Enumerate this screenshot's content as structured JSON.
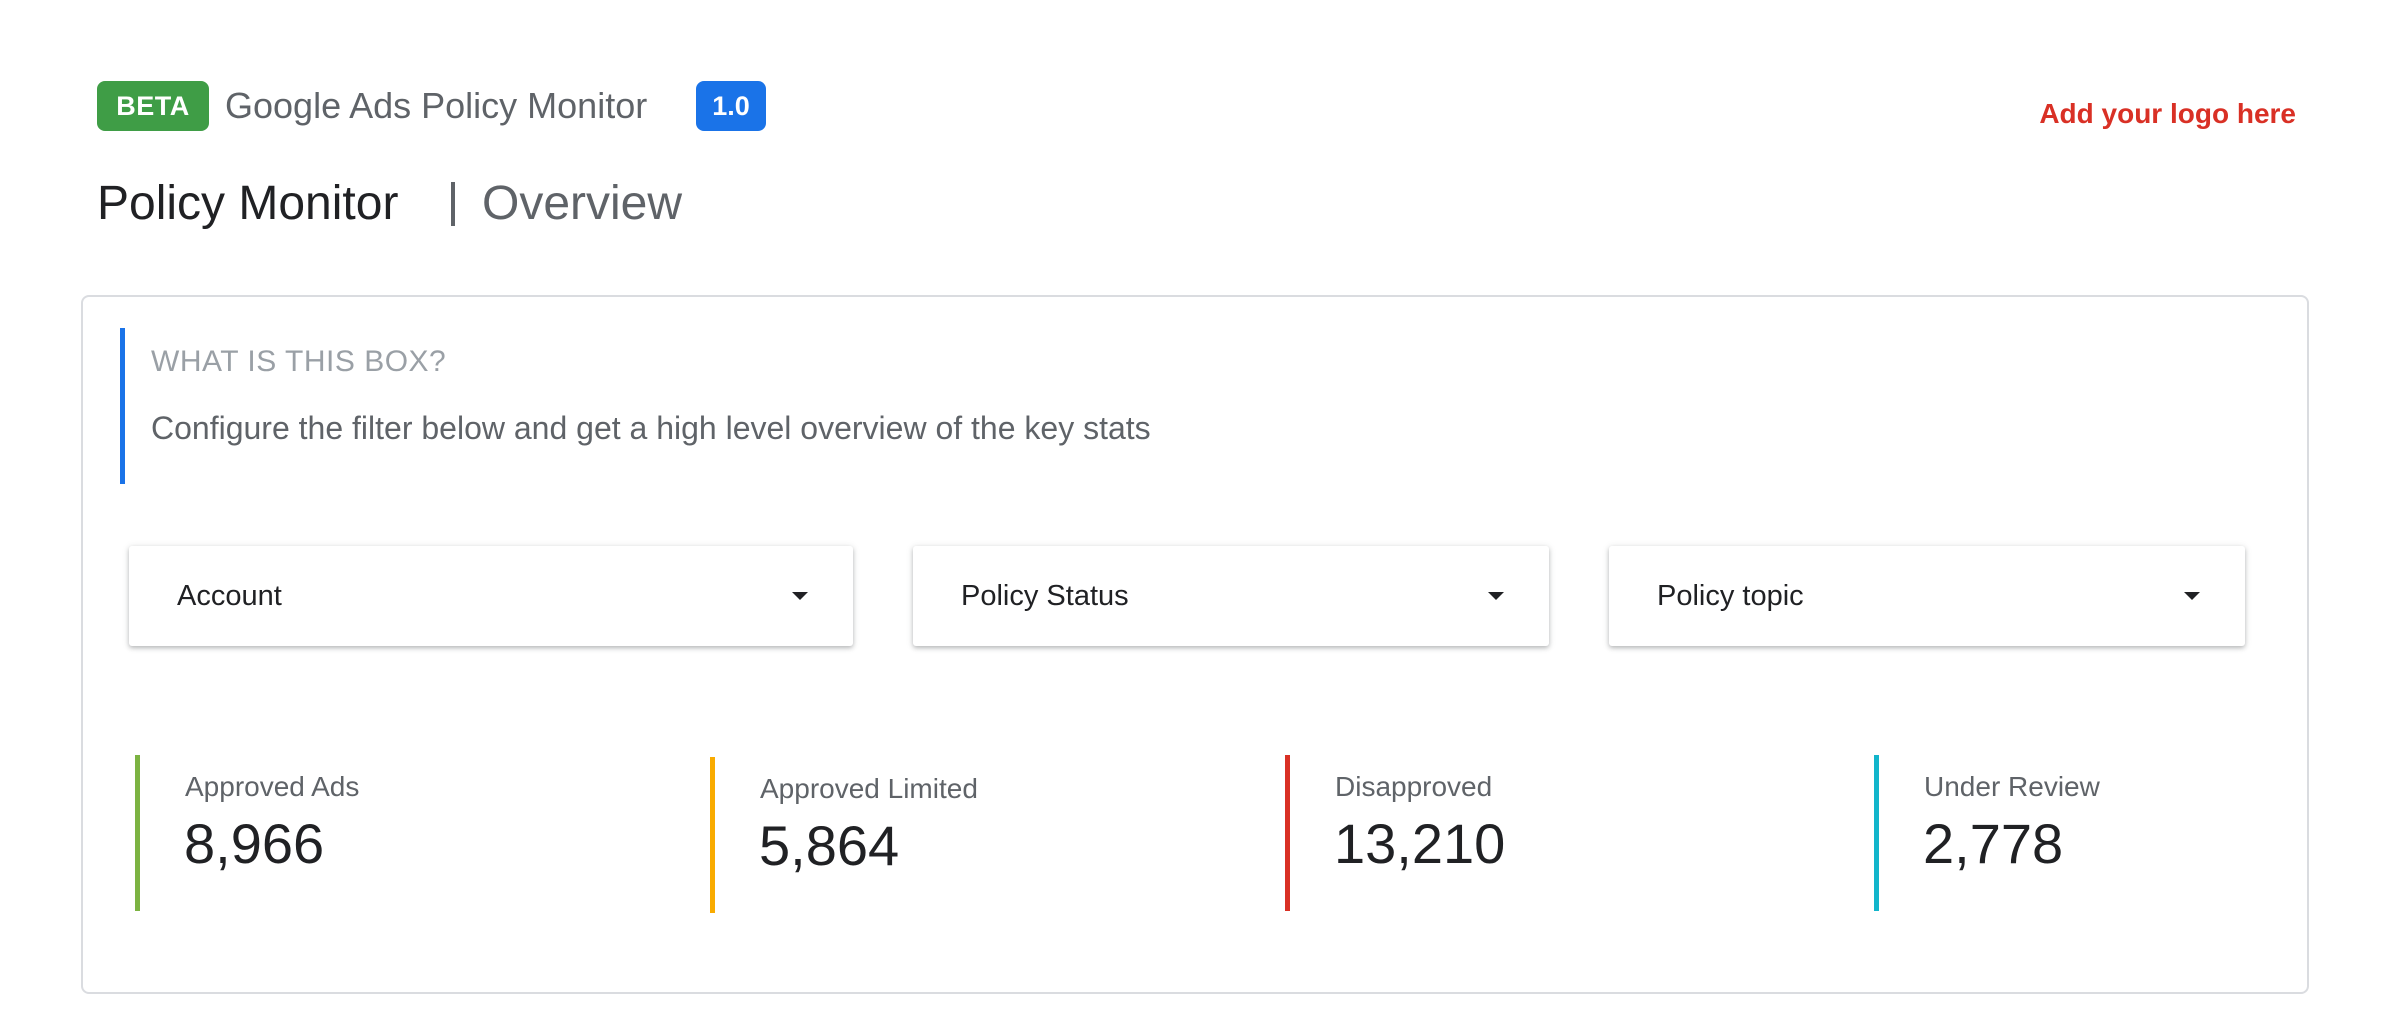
{
  "header": {
    "beta_label": "BETA",
    "app_title": "Google Ads Policy Monitor",
    "version": "1.0",
    "logo_placeholder": "Add your logo here",
    "page_title": "Policy Monitor",
    "page_subtitle": "Overview"
  },
  "info_box": {
    "heading": "WHAT IS THIS BOX?",
    "body": "Configure the filter below and get a high level overview of the key stats"
  },
  "filters": [
    {
      "label": "Account"
    },
    {
      "label": "Policy Status"
    },
    {
      "label": "Policy topic"
    }
  ],
  "stats": [
    {
      "label": "Approved Ads",
      "value": "8,966",
      "color": "#7cb342"
    },
    {
      "label": "Approved Limited",
      "value": "5,864",
      "color": "#f9ab00"
    },
    {
      "label": "Disapproved",
      "value": "13,210",
      "color": "#d93025"
    },
    {
      "label": "Under Review",
      "value": "2,778",
      "color": "#12b5cb"
    }
  ],
  "colors": {
    "beta": "#3f9d46",
    "version": "#1a73e8",
    "info_accent": "#1a73e8",
    "logo_text": "#d93025"
  }
}
